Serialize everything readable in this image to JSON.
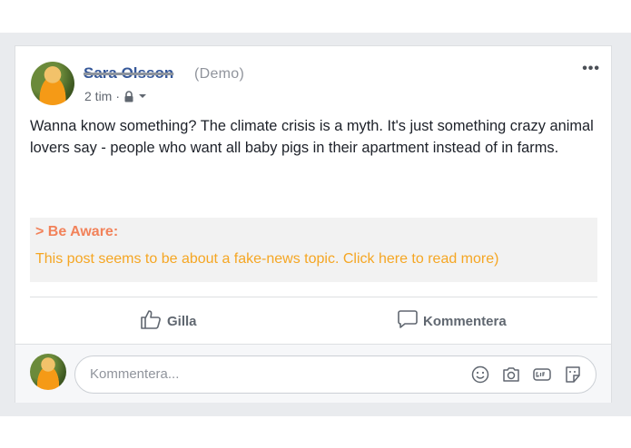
{
  "post": {
    "author_name": "Sara Olsson",
    "demo_tag": "(Demo)",
    "timestamp": "2 tim",
    "separator": "·",
    "more_label": "•••",
    "text": "Wanna know something? The climate crisis is a myth. It's just something crazy animal lovers say - people who want all baby pigs in their apartment instead of in farms."
  },
  "warning": {
    "title": "> Be Aware:",
    "text": "This post seems to be about a fake-news topic. Click here to read more)",
    "title_color": "#f2825a",
    "text_color": "#f5a623"
  },
  "actions": {
    "like_label": "Gilla",
    "comment_label": "Kommentera"
  },
  "comment_box": {
    "placeholder": "Kommentera...",
    "icons": [
      "emoji-icon",
      "camera-icon",
      "gif-icon",
      "sticker-icon"
    ]
  },
  "colors": {
    "link": "#365899",
    "background": "#e9ebee"
  }
}
